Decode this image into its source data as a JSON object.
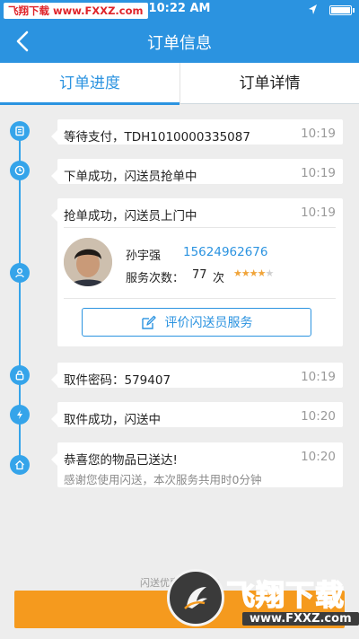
{
  "status_bar": {
    "watermark": "飞翔下载 www.FXXZ.com",
    "time": "10:22 AM"
  },
  "nav": {
    "title": "订单信息"
  },
  "tabs": [
    {
      "label": "订单进度",
      "active": true
    },
    {
      "label": "订单详情",
      "active": false
    }
  ],
  "timeline": [
    {
      "icon": "receipt-icon",
      "text": "等待支付，TDH1010000335087",
      "time": "10:19"
    },
    {
      "icon": "clock-icon",
      "text": "下单成功，闪送员抢单中",
      "time": "10:19"
    },
    {
      "icon": "person-icon",
      "text": "抢单成功，闪送员上门中",
      "time": "10:19"
    },
    {
      "icon": "lock-icon",
      "text": "取件密码：579407",
      "time": "10:19"
    },
    {
      "icon": "lightning-icon",
      "text": "取件成功，闪送中",
      "time": "10:20"
    },
    {
      "icon": "home-icon",
      "text": "恭喜您的物品已送达!",
      "time": "10:20",
      "sub": "感谢您使用闪送，本次服务共用时0分钟"
    }
  ],
  "courier": {
    "name": "孙宇强",
    "phone": "15624962676",
    "service_label": "服务次数：",
    "service_count": "77",
    "service_unit": "次",
    "rating": 4,
    "rating_max": 5,
    "rate_button": "评价闪送员服务"
  },
  "bottom": {
    "coupon_note": "闪送优惠券已经准"
  },
  "watermark_logo": {
    "big": "飞翔下载",
    "url": "www.FXXZ.com"
  },
  "colors": {
    "brand_blue": "#2b93e0",
    "timeline_blue": "#35a4ea",
    "bottom_orange": "#f59a1e",
    "star": "#f0a43a"
  }
}
